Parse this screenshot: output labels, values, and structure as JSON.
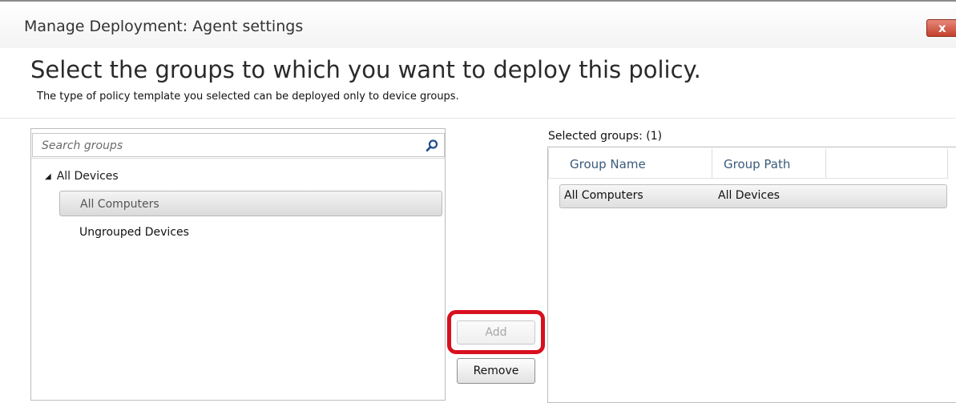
{
  "window": {
    "title": "Manage Deployment: Agent settings",
    "close_glyph": "x"
  },
  "header": {
    "heading": "Select the groups to which you want to deploy this policy.",
    "subtitle": "The type of policy template you selected can be deployed only to device groups."
  },
  "search": {
    "placeholder": "Search groups",
    "value": "",
    "icon": "search-icon"
  },
  "tree": {
    "root_arrow": "◢",
    "root_label": "All Devices",
    "items": [
      {
        "label": "All Computers",
        "selected": true
      },
      {
        "label": "Ungrouped Devices",
        "selected": false
      }
    ]
  },
  "actions": {
    "add_label": "Add",
    "add_enabled": false,
    "remove_label": "Remove",
    "highlight_color": "#d8101e"
  },
  "selected": {
    "label": "Selected groups: (1)",
    "columns": [
      "Group Name",
      "Group Path"
    ],
    "rows": [
      {
        "group_name": "All Computers",
        "group_path": "All Devices"
      }
    ]
  }
}
